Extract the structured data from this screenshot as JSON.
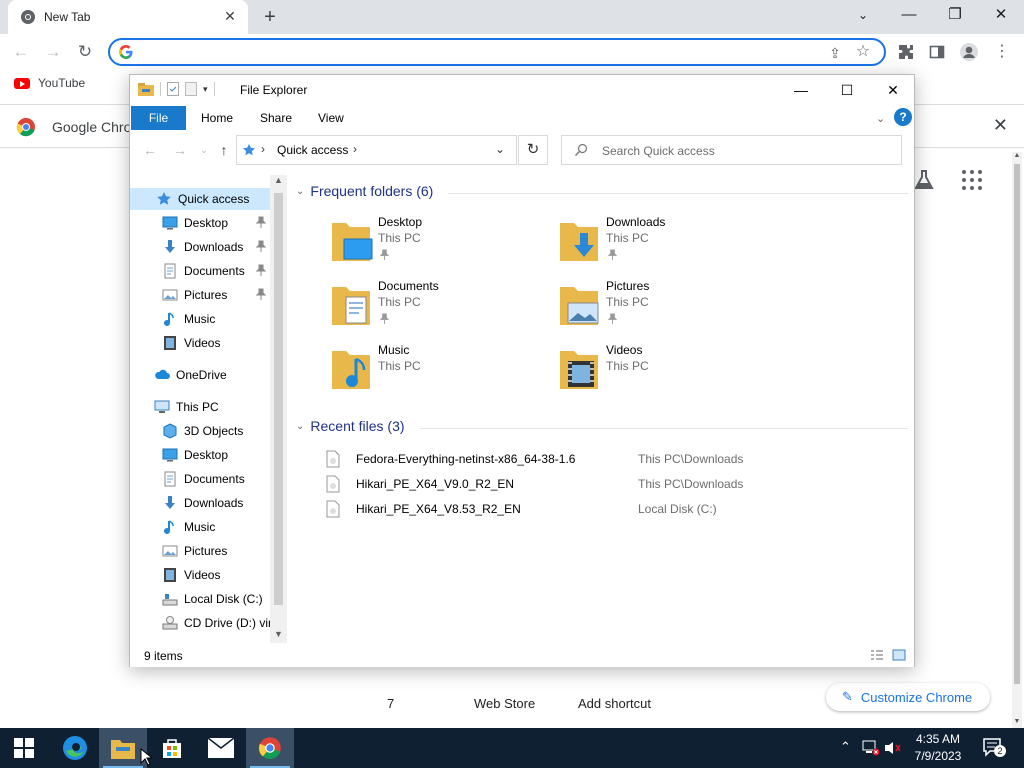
{
  "chrome": {
    "tab_title": "New Tab",
    "omnibox_value": "",
    "bookmark_youtube": "YouTube",
    "infobar_text": "Google Chrome",
    "shortcuts": [
      "7",
      "Web Store",
      "Add shortcut"
    ],
    "customize_label": "Customize Chrome",
    "accent_color": "#1a73e8"
  },
  "explorer": {
    "window_title": "File Explorer",
    "ribbon_tabs": {
      "file": "File",
      "home": "Home",
      "share": "Share",
      "view": "View"
    },
    "address_crumb": "Quick access",
    "search_placeholder": "Search Quick access",
    "nav": {
      "quick_access": "Quick access",
      "qa_items": [
        "Desktop",
        "Downloads",
        "Documents",
        "Pictures",
        "Music",
        "Videos"
      ],
      "onedrive": "OneDrive",
      "this_pc": "This PC",
      "pc_items": [
        "3D Objects",
        "Desktop",
        "Documents",
        "Downloads",
        "Music",
        "Pictures",
        "Videos",
        "Local Disk (C:)",
        "CD Drive (D:) virt"
      ]
    },
    "frequent_header": "Frequent folders (6)",
    "frequent": [
      {
        "name": "Desktop",
        "location": "This PC"
      },
      {
        "name": "Downloads",
        "location": "This PC"
      },
      {
        "name": "Documents",
        "location": "This PC"
      },
      {
        "name": "Pictures",
        "location": "This PC"
      },
      {
        "name": "Music",
        "location": "This PC"
      },
      {
        "name": "Videos",
        "location": "This PC"
      }
    ],
    "recent_header": "Recent files (3)",
    "recent": [
      {
        "name": "Fedora-Everything-netinst-x86_64-38-1.6",
        "location": "This PC\\Downloads"
      },
      {
        "name": "Hikari_PE_X64_V9.0_R2_EN",
        "location": "This PC\\Downloads"
      },
      {
        "name": "Hikari_PE_X64_V8.53_R2_EN",
        "location": "Local Disk (C:)"
      }
    ],
    "status_count": "9 items",
    "accent_color": "#1979ca"
  },
  "taskbar": {
    "time": "4:35 AM",
    "date": "7/9/2023",
    "notification_count": "2"
  }
}
